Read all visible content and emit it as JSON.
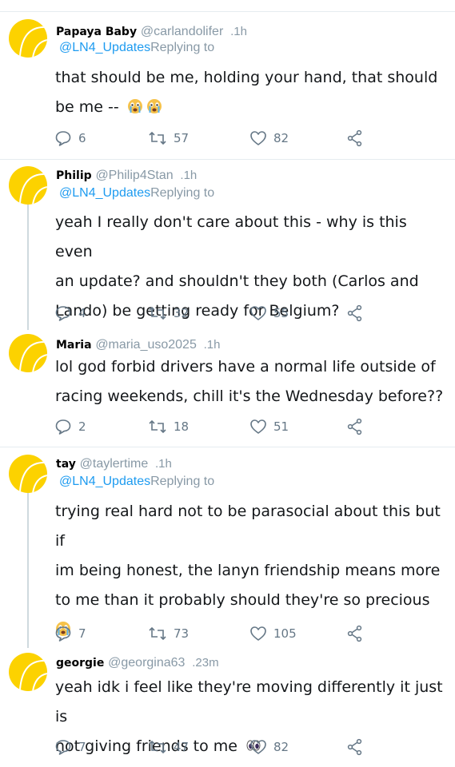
{
  "replying_to_label": "Replying to",
  "tweets": [
    {
      "name": "Papaya Baby",
      "handle": "@carlandolifer",
      "time": ".1h",
      "reply_mention": "@LN4_Updates",
      "text_lines": [
        "that should be me, holding your hand, that should",
        "be me -- "
      ],
      "emoji": [
        "crying-face",
        "crying-face"
      ],
      "replies": "6",
      "retweets": "57",
      "likes": "82"
    },
    {
      "name": "Philip",
      "handle": "@Philip4Stan",
      "time": ".1h",
      "reply_mention": "@LN4_Updates",
      "text_lines": [
        "yeah I really don't care about this - why is this even",
        "an update? and shouldn't they both (Carlos and",
        "Lando) be getting ready for Belgium?"
      ],
      "replies": "4",
      "retweets": "32",
      "likes": "55"
    },
    {
      "name": "Maria",
      "handle": "@maria_uso2025",
      "time": ".1h",
      "text_lines": [
        "lol god forbid drivers have a normal life outside of",
        "racing weekends, chill it's the Wednesday before??"
      ],
      "replies": "2",
      "retweets": "18",
      "likes": "51"
    },
    {
      "name": "tay",
      "handle": "@taylertime",
      "time": ".1h",
      "reply_mention": "@LN4_Updates",
      "text_lines": [
        "trying real hard not to be parasocial about this but if",
        "im being honest, the lanyn friendship means more",
        "to me than it probably should they're so precious"
      ],
      "emoji": [
        "crying-face"
      ],
      "replies": "7",
      "retweets": "73",
      "likes": "105"
    },
    {
      "name": "georgie",
      "handle": "@georgina63",
      "time": ".23m",
      "text_lines": [
        "yeah idk i feel like they're moving differently it just is",
        "not giving friends to me "
      ],
      "emoji": [
        "eyes"
      ],
      "replies": "7",
      "retweets": "47",
      "likes": "82"
    }
  ],
  "colors": {
    "avatar": "#fcd200",
    "mention": "#1d9bf0",
    "muted": "#8899a6",
    "icon": "#657786",
    "divider": "#e6ecf0"
  }
}
